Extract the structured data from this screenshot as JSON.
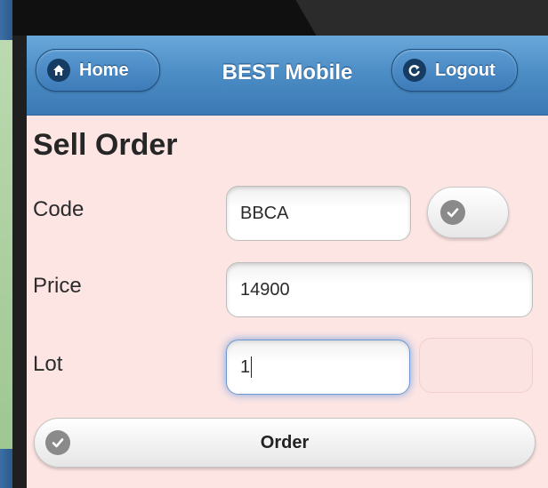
{
  "header": {
    "title": "BEST Mobile",
    "home_label": "Home",
    "logout_label": "Logout"
  },
  "page": {
    "title": "Sell Order"
  },
  "form": {
    "code": {
      "label": "Code",
      "value": "BBCA"
    },
    "price": {
      "label": "Price",
      "value": "14900"
    },
    "lot": {
      "label": "Lot",
      "value": "1"
    }
  },
  "order_button": {
    "label": "Order"
  },
  "colors": {
    "header_blue": "#4d8ec6",
    "page_background": "#fde5e3",
    "focus_glow": "#7ea4dd"
  },
  "icons": [
    "home-icon",
    "logout-icon",
    "check-icon"
  ]
}
